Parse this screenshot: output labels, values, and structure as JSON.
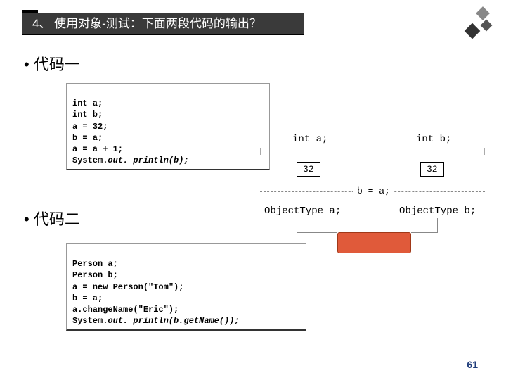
{
  "title": "4、 使用对象-测试：下面两段代码的输出？",
  "bullet1": "• 代码一",
  "bullet2": "• 代码二",
  "code1": {
    "l1": "int a;",
    "l2": "int b;",
    "l3": "a = 32;",
    "l4": "b = a;",
    "l5": "a = a + 1;",
    "l6a": "System.",
    "l6b": "out. println(b);"
  },
  "code2": {
    "l1": "Person a;",
    "l2": "Person b;",
    "l3": "a = new Person(\"Tom\");",
    "l4": "b = a;",
    "l5": "a.changeName(\"Eric\");",
    "l6a": "System.",
    "l6b": "out. println(b.getName());"
  },
  "diagram": {
    "int_a": "int a;",
    "int_b": "int b;",
    "val_a": "32",
    "val_b": "32",
    "mid": "b = a;",
    "obj_a": "ObjectType a;",
    "obj_b": "ObjectType b;"
  },
  "page": "61"
}
